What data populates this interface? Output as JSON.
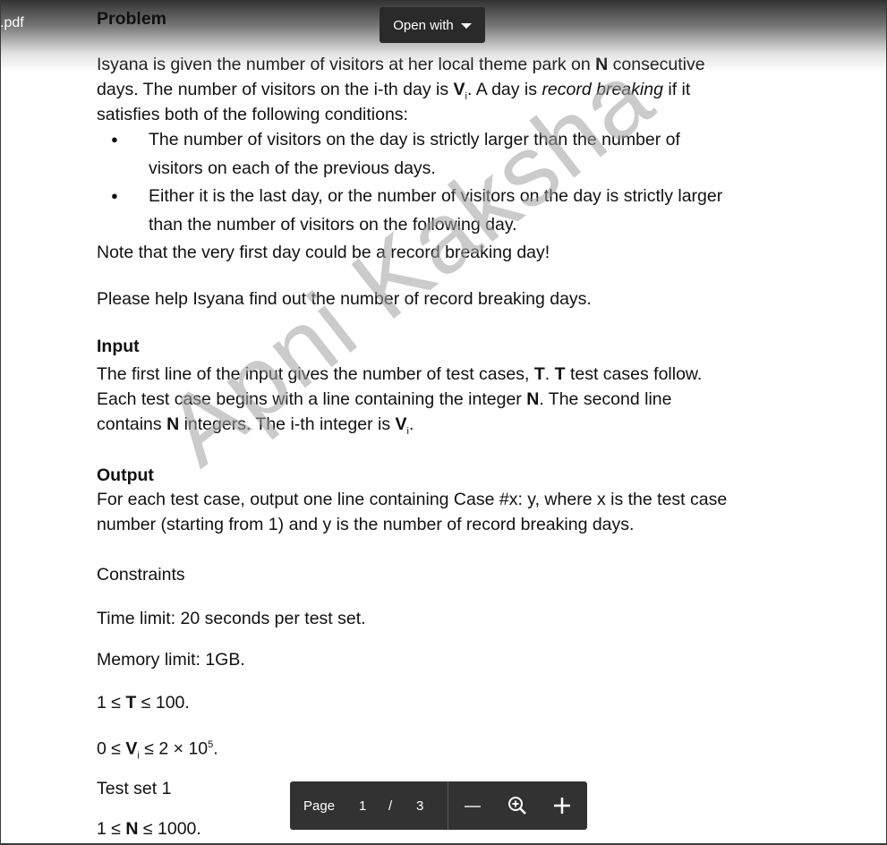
{
  "viewer": {
    "filename": ".pdf",
    "open_with_label": "Open with",
    "pagebar": {
      "page_label": "Page",
      "current_page": "1",
      "separator": "/",
      "total_pages": "3"
    }
  },
  "document": {
    "problem_heading": "Problem",
    "intro_line1_a": "Isyana is given the number of visitors at her local theme park on ",
    "intro_line1_b": "N",
    "intro_line1_c": " consecutive",
    "intro_line2_a": "days. The number of visitors on the i-th day is ",
    "intro_line2_b": "V",
    "intro_line2_sub": "i",
    "intro_line2_c": ". A day is ",
    "intro_line2_d": "record breaking",
    "intro_line2_e": " if it",
    "intro_line3": "satisfies both of the following conditions:",
    "bullet1_line1": "The number of visitors on the day is strictly larger than the number of",
    "bullet1_line2": "visitors on each of the previous days.",
    "bullet2_line1": "Either it is the last day, or the number of visitors on the day is strictly larger",
    "bullet2_line2": "than the number of visitors on the following day.",
    "note": "Note that the very first day could be a record breaking day!",
    "help": "Please help Isyana find out the number of record breaking days.",
    "input_heading": "Input",
    "input_line1_a": "The first line of the input gives the number of test cases, ",
    "input_line1_b": "T",
    "input_line1_c": ". ",
    "input_line1_d": "T",
    "input_line1_e": " test cases follow.",
    "input_line2_a": "Each test case begins with a line containing the integer ",
    "input_line2_b": "N",
    "input_line2_c": ". The second line",
    "input_line3_a": "contains ",
    "input_line3_b": "N",
    "input_line3_c": " integers. The i-th integer is ",
    "input_line3_d": "V",
    "input_line3_sub": "i",
    "input_line3_e": ".",
    "output_heading": "Output",
    "output_line1": "For each test case, output one line containing Case #x: y, where x is the test case",
    "output_line2": "number (starting from 1) and y is the number of record breaking days.",
    "constraints": "Constraints",
    "time_limit": "Time limit: 20 seconds per test set.",
    "memory_limit": "Memory limit: 1GB.",
    "c1_a": "1 ≤ ",
    "c1_b": "T",
    "c1_c": " ≤ 100.",
    "c2_a": "0 ≤ ",
    "c2_b": "V",
    "c2_sub": "i",
    "c2_c": " ≤ 2 × 10",
    "c2_sup": "5",
    "c2_d": ".",
    "test_set": "Test set 1",
    "c3_a": "1 ≤ ",
    "c3_b": "N",
    "c3_c": " ≤ 1000."
  },
  "watermark": "Apni Kaksha"
}
